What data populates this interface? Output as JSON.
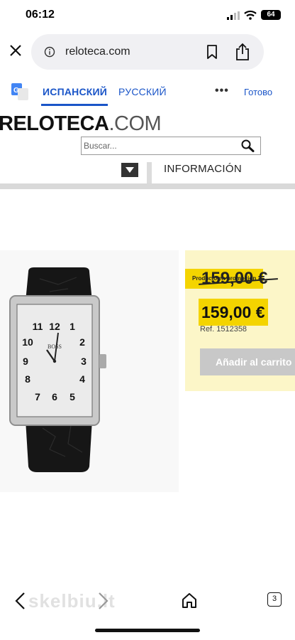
{
  "status_bar": {
    "time": "06:12",
    "battery": "64"
  },
  "browser": {
    "url": "reloteca.com"
  },
  "translate_bar": {
    "source_language": "ИСПАНСКИЙ",
    "target_language": "РУССКИЙ",
    "more": "•••",
    "done": "Готово"
  },
  "site": {
    "logo_main": "RELOTECA",
    "logo_suffix": ".COM",
    "search_placeholder": "Buscar...",
    "nav_info": "INFORMACIÓN"
  },
  "product": {
    "promo_label": "Producto en promoción",
    "old_price": "159,00 €",
    "price": "159,00 €",
    "ref": "Ref. 1512358",
    "add_to_cart": "Añadir al carrito",
    "watch_brand": "BOSS",
    "dial_numbers": [
      "12",
      "1",
      "2",
      "3",
      "4",
      "5",
      "6",
      "7",
      "8",
      "9",
      "10",
      "11"
    ]
  },
  "toolbar": {
    "watermark": "skelbiu.lt",
    "tab_count": "3"
  },
  "colors": {
    "link_blue": "#1a55c8",
    "promo_yellow": "#f4d400",
    "price_box": "#fcf6c8"
  }
}
